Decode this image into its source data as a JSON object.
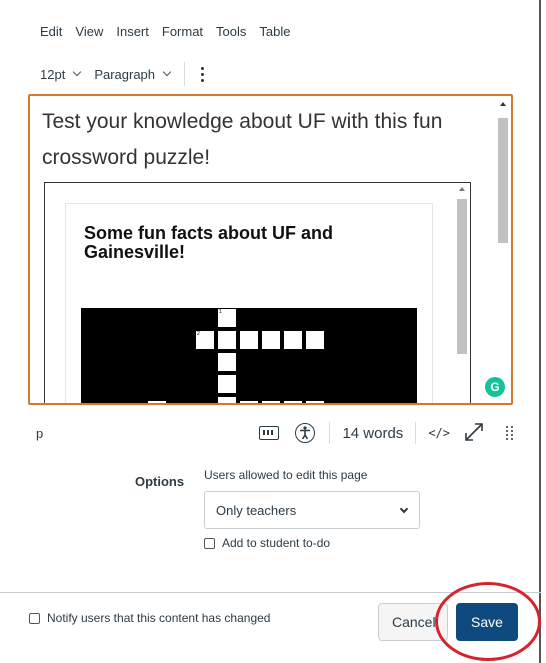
{
  "menubar": {
    "items": [
      "Edit",
      "View",
      "Insert",
      "Format",
      "Tools",
      "Table"
    ]
  },
  "toolbar": {
    "font_size": "12pt",
    "block_format": "Paragraph"
  },
  "editor": {
    "intro_text": "Test your knowledge about UF with this fun crossword puzzle!",
    "embed_title": "Some fun facts about UF and Gainesville!",
    "puzzle_numbers": [
      "1",
      "2"
    ]
  },
  "statusbar": {
    "path": "p",
    "word_count": "14 words",
    "html_toggle_label": "</>"
  },
  "options": {
    "label": "Options",
    "edit_permission_label": "Users allowed to edit this page",
    "edit_permission_value": "Only teachers",
    "todo_label": "Add to student to-do"
  },
  "footer": {
    "notify_label": "Notify users that this content has changed",
    "cancel_label": "Cancel",
    "save_label": "Save"
  },
  "colors": {
    "editor_focus_border": "#d9782b",
    "save_button": "#0e4a7e",
    "highlight_ring": "#d6232d",
    "grammarly": "#15c39a"
  }
}
